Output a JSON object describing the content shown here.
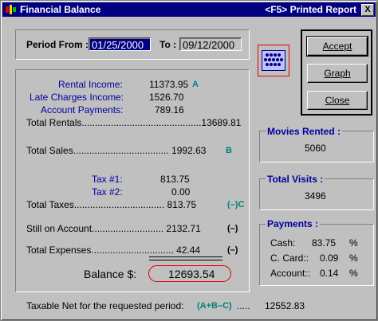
{
  "window": {
    "title": "Financial Balance",
    "shortcut_hint": "<F5> Printed Report",
    "close_label": "X"
  },
  "period": {
    "from_label": "Period From :",
    "from_value": "01/25/2000",
    "to_label": "To :",
    "to_value": "09/12/2000"
  },
  "income": {
    "rental_income_label": "Rental Income:",
    "rental_income_value": "11373.95",
    "rental_income_mark": "A",
    "late_charges_label": "Late Charges Income:",
    "late_charges_value": "1526.70",
    "account_payments_label": "Account Payments:",
    "account_payments_value": "789.16",
    "total_rentals_label": "Total Rentals.............................................13689.81",
    "total_sales_label": "Total Sales.................................... 1992.63",
    "total_sales_mark": "B"
  },
  "taxes": {
    "tax1_label": "Tax #1:",
    "tax1_value": "813.75",
    "tax2_label": "Tax #2:",
    "tax2_value": "0.00",
    "total_taxes_label": "Total Taxes.................................. 813.75",
    "total_taxes_mark": "(–)C"
  },
  "other": {
    "still_on_account_label": "Still on Account........................... 2132.71",
    "still_on_account_mark": "(–)",
    "total_expenses_label": "Total Expenses...............................   42.44",
    "total_expenses_mark": "(–)"
  },
  "balance": {
    "label": "Balance $:",
    "value": "12693.54"
  },
  "buttons": {
    "accept": "Accept",
    "graph": "Graph",
    "close": "Close"
  },
  "movies_rented": {
    "title": "Movies Rented :",
    "value": "5060"
  },
  "total_visits": {
    "title": "Total Visits :",
    "value": "3496"
  },
  "payments": {
    "title": "Payments :",
    "cash_label": "Cash:",
    "cash_value": "83.75",
    "cash_unit": "%",
    "card_label": "C. Card::",
    "card_value": "0.09",
    "card_unit": "%",
    "account_label": "Account::",
    "account_value": "0.14",
    "account_unit": "%"
  },
  "footer": {
    "taxable_net_label": "Taxable Net for the requested period:",
    "formula": "(A+B–C)",
    "dots": ".....",
    "value": "12552.83"
  },
  "colors": {
    "titlebar": "#000080",
    "label_blue": "#0000a0",
    "mark_teal": "#008080",
    "balance_oval": "#e00000"
  }
}
